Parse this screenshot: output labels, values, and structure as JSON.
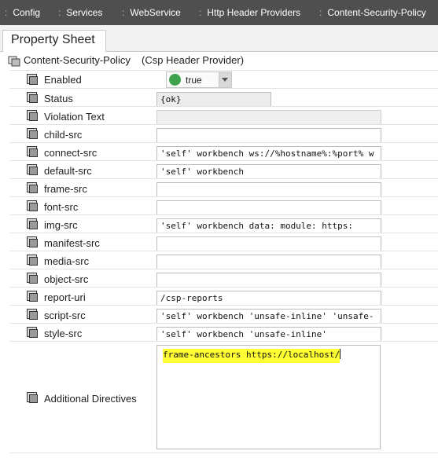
{
  "breadcrumb": [
    "Config",
    "Services",
    "WebService",
    "Http Header Providers",
    "Content-Security-Policy"
  ],
  "tab": {
    "label": "Property Sheet"
  },
  "component": {
    "name": "Content-Security-Policy",
    "type": "(Csp Header Provider)"
  },
  "properties": [
    {
      "label": "Enabled",
      "value": "true"
    },
    {
      "label": "Status",
      "value": "{ok}"
    },
    {
      "label": "Violation Text",
      "value": ""
    },
    {
      "label": "child-src",
      "value": ""
    },
    {
      "label": "connect-src",
      "value": "'self' workbench ws://%hostname%:%port% w"
    },
    {
      "label": "default-src",
      "value": "'self' workbench"
    },
    {
      "label": "frame-src",
      "value": ""
    },
    {
      "label": "font-src",
      "value": ""
    },
    {
      "label": "img-src",
      "value": "'self' workbench data: module: https:"
    },
    {
      "label": "manifest-src",
      "value": ""
    },
    {
      "label": "media-src",
      "value": ""
    },
    {
      "label": "object-src",
      "value": ""
    },
    {
      "label": "report-uri",
      "value": "/csp-reports"
    },
    {
      "label": "script-src",
      "value": "'self' workbench 'unsafe-inline' 'unsafe-"
    },
    {
      "label": "style-src",
      "value": "'self' workbench 'unsafe-inline'"
    },
    {
      "label": "Additional Directives",
      "value": "frame-ancestors https://localhost/"
    }
  ],
  "colors": {
    "navbar": "#4f4f4f",
    "status_ok": "#3fa34d",
    "highlight": "#ffff33"
  },
  "icons": {
    "property": "slot-icon",
    "component": "component-icon"
  }
}
